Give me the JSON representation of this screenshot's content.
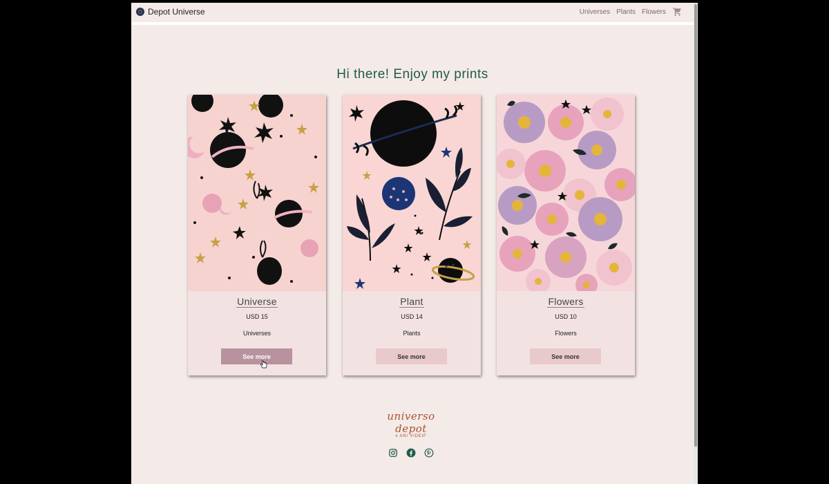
{
  "nav": {
    "brand": "Depot Universe",
    "links": [
      "Universes",
      "Plants",
      "Flowers"
    ],
    "cart_icon": "cart-icon"
  },
  "headline": "Hi there! Enjoy my prints",
  "products": [
    {
      "title": "Universe",
      "price": "USD 15",
      "category": "Universes",
      "button": "See more",
      "state": "hover"
    },
    {
      "title": "Plant",
      "price": "USD 14",
      "category": "Plants",
      "button": "See more"
    },
    {
      "title": "Flowers",
      "price": "USD 10",
      "category": "Flowers",
      "button": "See more"
    }
  ],
  "footer": {
    "signature": "universo depot",
    "signature_sub": "x ANI VIDEIF",
    "socials": [
      "instagram-icon",
      "facebook-icon",
      "pinterest-icon"
    ]
  },
  "colors": {
    "page_bg": "#f4eae8",
    "headline": "#1f5a4a",
    "button": "#e8c9cc",
    "button_hover": "#b8929f",
    "social": "#1f5a4a",
    "signature": "#a9532d"
  }
}
